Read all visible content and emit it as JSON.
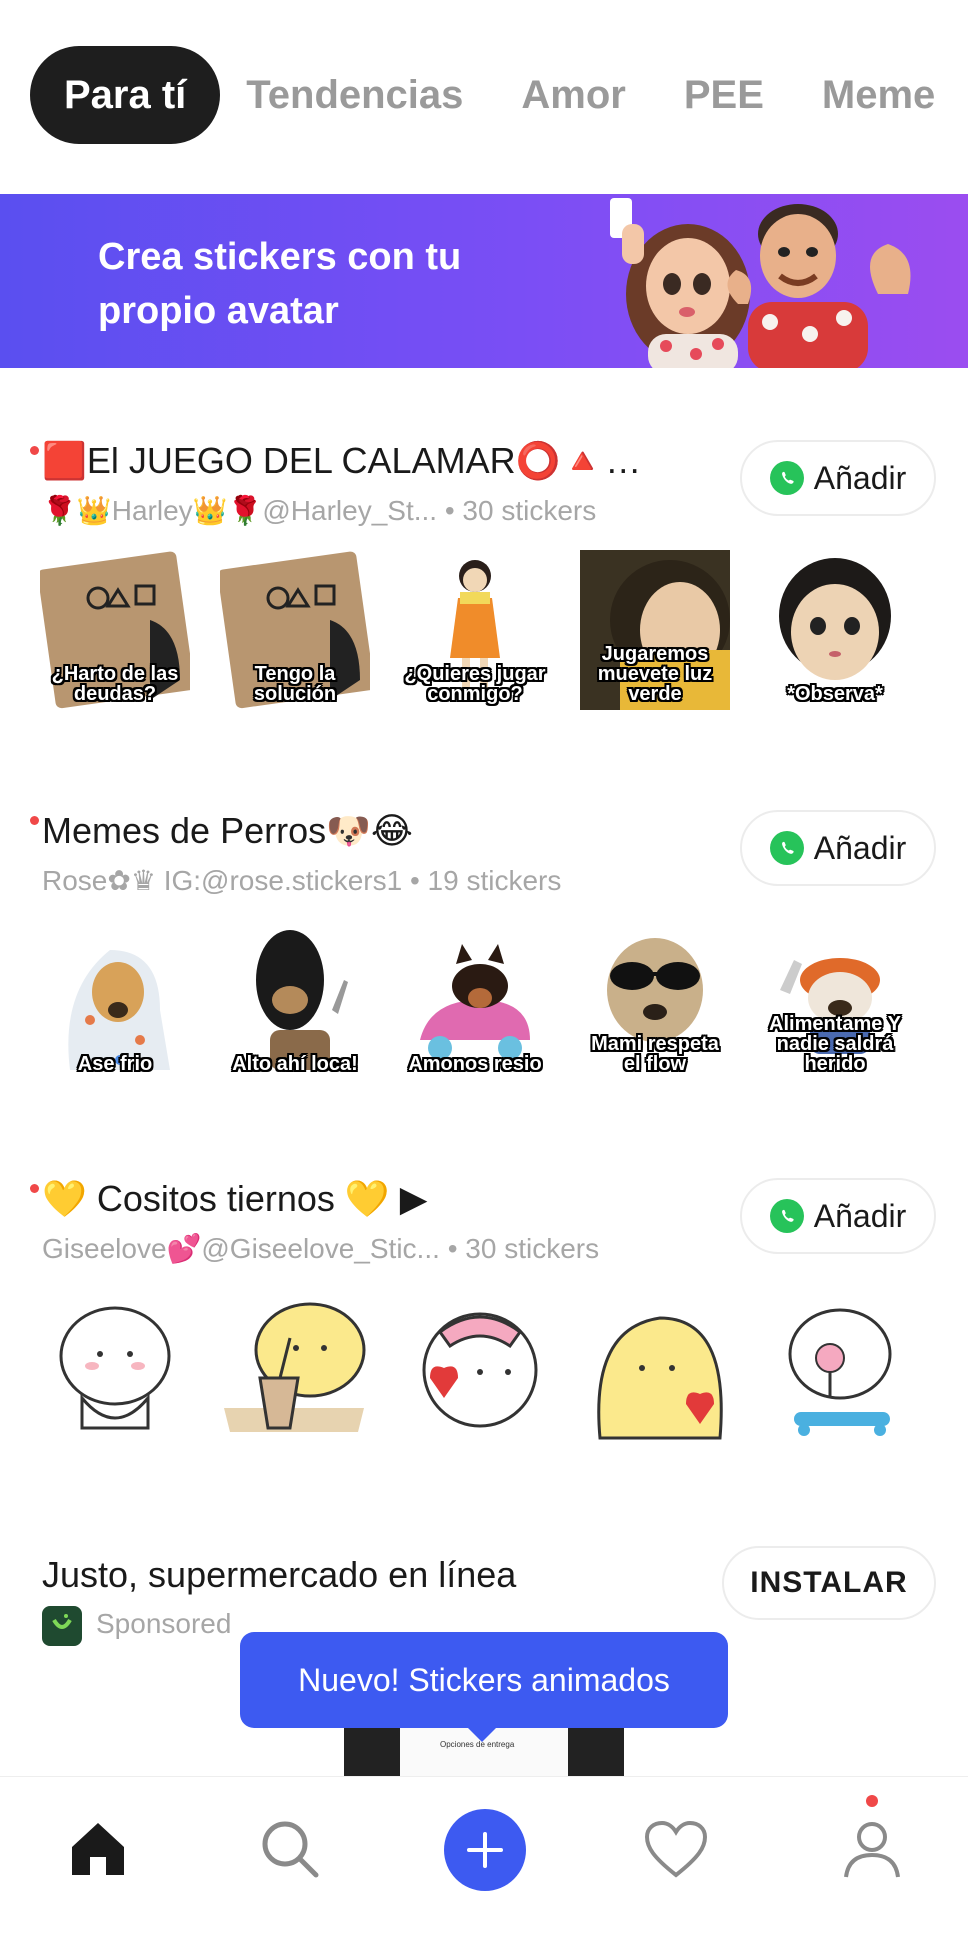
{
  "tabs": [
    {
      "label": "Para tí",
      "active": true
    },
    {
      "label": "Tendencias",
      "active": false
    },
    {
      "label": "Amor",
      "active": false
    },
    {
      "label": "PEE",
      "active": false
    },
    {
      "label": "Meme",
      "active": false
    }
  ],
  "banner": {
    "line1": "Crea stickers con tu",
    "line2": "propio avatar"
  },
  "packs": [
    {
      "title": "🟥El JUEGO DEL CALAMAR⭕🔺…",
      "author": "🌹👑Harley👑🌹@Harley_St...",
      "count": "• 30 stickers",
      "add_label": "Añadir",
      "stickers": [
        {
          "caption": "¿Harto de las deudas?",
          "icon": "squid-card"
        },
        {
          "caption": "Tengo la solución",
          "icon": "squid-card"
        },
        {
          "caption": "¿Quieres jugar conmigo?",
          "icon": "doll"
        },
        {
          "caption": "Jugaremos muevete luz verde",
          "icon": "doll-closeup"
        },
        {
          "caption": "*Observa*",
          "icon": "doll-face"
        }
      ]
    },
    {
      "title": "Memes de Perros🐶😂",
      "author": "Rose✿♛ IG:@rose.stickers1",
      "count": "• 19 stickers",
      "add_label": "Añadir",
      "stickers": [
        {
          "caption": "Ase frio",
          "icon": "dog-blanket"
        },
        {
          "caption": "Alto ahí loca!",
          "icon": "dog-mask"
        },
        {
          "caption": "Amonos resio",
          "icon": "dog-car"
        },
        {
          "caption": "Mami respeta el flow",
          "icon": "dog-glasses"
        },
        {
          "caption": "Alimentame Y nadie saldrá herido",
          "icon": "dog-chucky"
        }
      ]
    },
    {
      "title": "💛 Cositos tiernos 💛 ▶",
      "author": "Giseelove💕@Giseelove_Stic...",
      "count": "• 30 stickers",
      "add_label": "Añadir",
      "stickers": [
        {
          "caption": "",
          "icon": "cute-white"
        },
        {
          "caption": "",
          "icon": "cute-yellow-drink"
        },
        {
          "caption": "",
          "icon": "cute-bow-heart"
        },
        {
          "caption": "",
          "icon": "cute-yellow-heart"
        },
        {
          "caption": "",
          "icon": "cute-lollipop"
        }
      ]
    }
  ],
  "sponsored": {
    "title": "Justo, supermercado en línea",
    "label": "Sponsored",
    "install_label": "INSTALAR",
    "preview_text": "Opciones de entrega"
  },
  "tooltip": "Nuevo! Stickers animados",
  "nav": [
    "home-icon",
    "search-icon",
    "add-icon",
    "heart-icon",
    "profile-icon"
  ],
  "colors": {
    "accent": "#3d5af1",
    "whatsapp": "#27c35a",
    "badge": "#f04848",
    "banner_start": "#5a4ff0",
    "banner_end": "#9b4df0"
  }
}
